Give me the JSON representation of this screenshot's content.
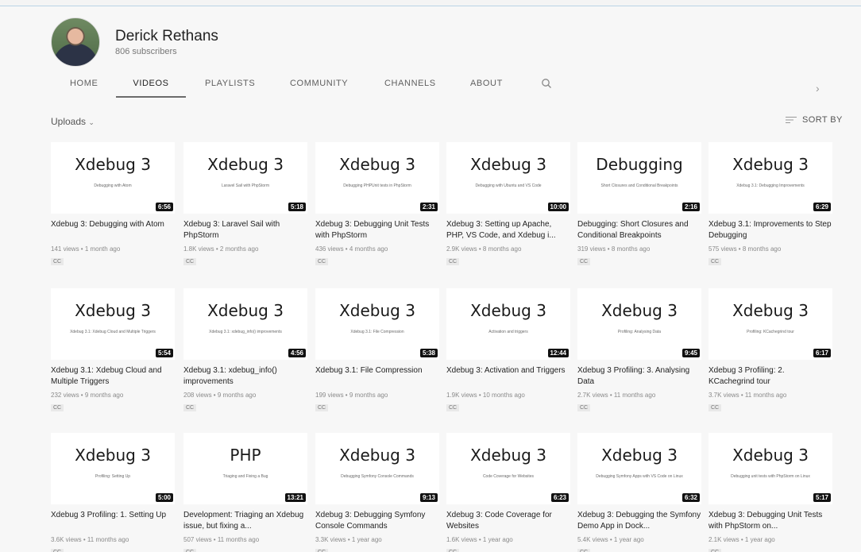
{
  "channel": {
    "name": "Derick Rethans",
    "subscribers": "806 subscribers"
  },
  "tabs": [
    "HOME",
    "VIDEOS",
    "PLAYLISTS",
    "COMMUNITY",
    "CHANNELS",
    "ABOUT"
  ],
  "active_tab": "VIDEOS",
  "toolbar": {
    "uploads_label": "Uploads",
    "sort_label": "SORT BY"
  },
  "icons": {
    "search": "search-icon",
    "next": "chevron-right-icon",
    "dropdown": "chevron-down-icon",
    "sort": "sort-icon"
  },
  "videos": [
    {
      "thumb_title": "Xdebug 3",
      "thumb_sub": "Debugging with Atom",
      "duration": "6:56",
      "title": "Xdebug 3: Debugging with Atom",
      "meta": "141 views • 1 month ago",
      "cc": "CC"
    },
    {
      "thumb_title": "Xdebug 3",
      "thumb_sub": "Laravel Sail with PhpStorm",
      "duration": "5:18",
      "title": "Xdebug 3: Laravel Sail with PhpStorm",
      "meta": "1.8K views • 2 months ago",
      "cc": "CC"
    },
    {
      "thumb_title": "Xdebug 3",
      "thumb_sub": "Debugging PHPUnit tests in PhpStorm",
      "duration": "2:31",
      "title": "Xdebug 3: Debugging Unit Tests with PhpStorm",
      "meta": "436 views • 4 months ago",
      "cc": "CC"
    },
    {
      "thumb_title": "Xdebug 3",
      "thumb_sub": "Debugging with Ubuntu and VS Code",
      "duration": "10:00",
      "title": "Xdebug 3: Setting up Apache, PHP, VS Code, and Xdebug i...",
      "meta": "2.9K views • 8 months ago",
      "cc": "CC"
    },
    {
      "thumb_title": "Debugging",
      "thumb_sub": "Short Closures and Conditional Breakpoints",
      "duration": "2:16",
      "title": "Debugging: Short Closures and Conditional Breakpoints",
      "meta": "319 views • 8 months ago",
      "cc": "CC"
    },
    {
      "thumb_title": "Xdebug 3",
      "thumb_sub": "Xdebug 3.1: Debugging Improvements",
      "duration": "6:29",
      "title": "Xdebug 3.1: Improvements to Step Debugging",
      "meta": "575 views • 8 months ago",
      "cc": "CC"
    },
    {
      "thumb_title": "Xdebug 3",
      "thumb_sub": "Xdebug 3.1: Xdebug Cloud and Multiple Triggers",
      "duration": "5:54",
      "title": "Xdebug 3.1: Xdebug Cloud and Multiple Triggers",
      "meta": "232 views • 9 months ago",
      "cc": "CC"
    },
    {
      "thumb_title": "Xdebug 3",
      "thumb_sub": "Xdebug 3.1: xdebug_info() improvements",
      "duration": "4:56",
      "title": "Xdebug 3.1: xdebug_info() improvements",
      "meta": "208 views • 9 months ago",
      "cc": "CC"
    },
    {
      "thumb_title": "Xdebug 3",
      "thumb_sub": "Xdebug 3.1: File Compression",
      "duration": "5:38",
      "title": "Xdebug 3.1: File Compression",
      "meta": "199 views • 9 months ago",
      "cc": "CC"
    },
    {
      "thumb_title": "Xdebug 3",
      "thumb_sub": "Activation and triggers",
      "duration": "12:44",
      "title": "Xdebug 3: Activation and Triggers",
      "meta": "1.9K views • 10 months ago",
      "cc": "CC"
    },
    {
      "thumb_title": "Xdebug 3",
      "thumb_sub": "Profiling: Analysing Data",
      "duration": "9:45",
      "title": "Xdebug 3 Profiling: 3. Analysing Data",
      "meta": "2.7K views • 11 months ago",
      "cc": "CC"
    },
    {
      "thumb_title": "Xdebug 3",
      "thumb_sub": "Profiling: KCachegrind tour",
      "duration": "6:17",
      "title": "Xdebug 3 Profiling: 2. KCachegrind tour",
      "meta": "3.7K views • 11 months ago",
      "cc": "CC"
    },
    {
      "thumb_title": "Xdebug 3",
      "thumb_sub": "Profiling: Setting Up",
      "duration": "5:00",
      "title": "Xdebug 3 Profiling: 1. Setting Up",
      "meta": "3.6K views • 11 months ago",
      "cc": "CC"
    },
    {
      "thumb_title": "PHP",
      "thumb_sub": "Triaging and Fixing a Bug",
      "duration": "13:21",
      "title": "Development: Triaging an Xdebug issue, but fixing a...",
      "meta": "507 views • 11 months ago",
      "cc": "CC"
    },
    {
      "thumb_title": "Xdebug 3",
      "thumb_sub": "Debugging Symfony Console Commands",
      "duration": "9:13",
      "title": "Xdebug 3: Debugging Symfony Console Commands",
      "meta": "3.3K views • 1 year ago",
      "cc": "CC"
    },
    {
      "thumb_title": "Xdebug 3",
      "thumb_sub": "Code Coverage for Websites",
      "duration": "6:23",
      "title": "Xdebug 3: Code Coverage for Websites",
      "meta": "1.6K views • 1 year ago",
      "cc": "CC"
    },
    {
      "thumb_title": "Xdebug 3",
      "thumb_sub": "Debugging Symfony Apps with VS Code on Linux",
      "duration": "6:32",
      "title": "Xdebug 3: Debugging the Symfony Demo App in Dock...",
      "meta": "5.4K views • 1 year ago",
      "cc": "CC"
    },
    {
      "thumb_title": "Xdebug 3",
      "thumb_sub": "Debugging unit tests with PhpStorm on Linux",
      "duration": "5:17",
      "title": "Xdebug 3: Debugging Unit Tests with PhpStorm on...",
      "meta": "2.1K views • 1 year ago",
      "cc": "CC"
    }
  ]
}
